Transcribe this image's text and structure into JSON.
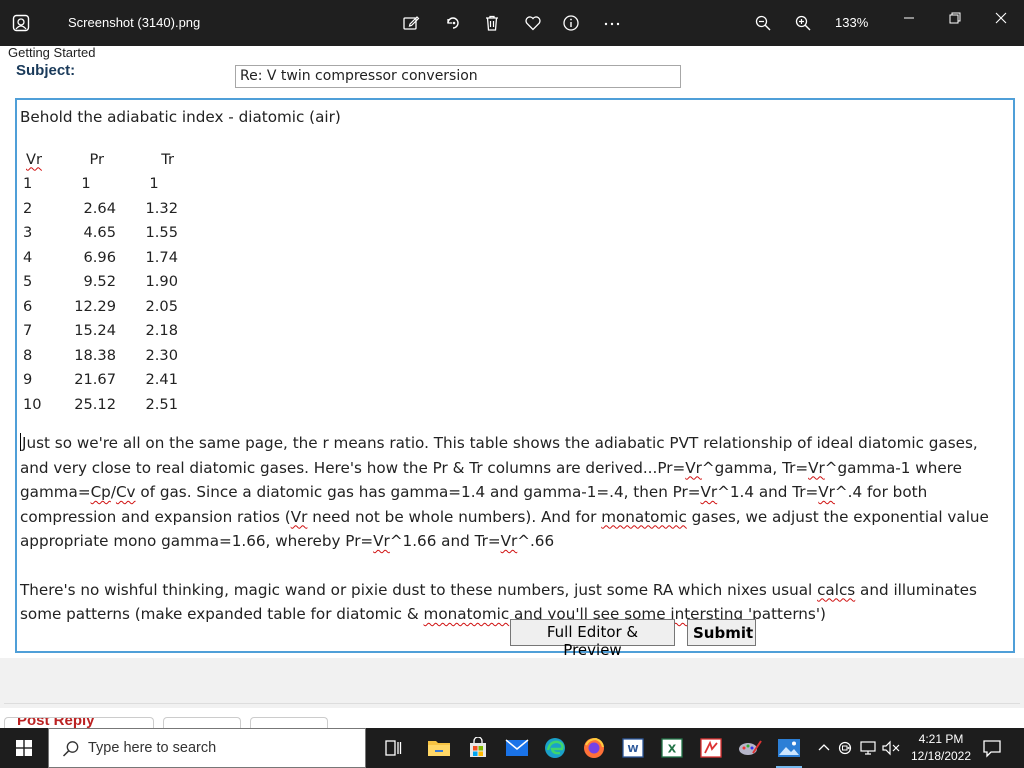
{
  "viewer": {
    "filename": "Screenshot (3140).png",
    "zoom_level": "133%",
    "toolbar_icons": [
      "edit-create-icon",
      "rotate-icon",
      "delete-icon",
      "favorite-heart-icon",
      "info-icon",
      "more-options-icon",
      "zoom-out-icon",
      "zoom-in-icon"
    ],
    "window_controls": [
      "minimize-icon",
      "restore-icon",
      "close-icon"
    ]
  },
  "page": {
    "breadcrumb": "Getting Started",
    "subject_label": "Subject:",
    "subject_value": "Re: V twin compressor conversion",
    "editor": {
      "intro": "Behold the adiabatic index - diatomic (air)",
      "table": {
        "headers": [
          "Vr",
          "Pr",
          "Tr"
        ],
        "rows": [
          [
            "1",
            "1",
            "1"
          ],
          [
            "2",
            "2.64",
            "1.32"
          ],
          [
            "3",
            "4.65",
            "1.55"
          ],
          [
            "4",
            "6.96",
            "1.74"
          ],
          [
            "5",
            "9.52",
            "1.90"
          ],
          [
            "6",
            "12.29",
            "2.05"
          ],
          [
            "7",
            "15.24",
            "2.18"
          ],
          [
            "8",
            "18.38",
            "2.30"
          ],
          [
            "9",
            "21.67",
            "2.41"
          ],
          [
            "10",
            "25.12",
            "2.51"
          ]
        ]
      },
      "paragraph1": {
        "p1": "Just so we're all on the same page, the r means ratio. This table shows the adiabatic PVT relationship of ideal diatomic gases, and very close to real diatomic gases. Here's how the Pr & Tr columns are derived...Pr=",
        "vr": "Vr",
        "p2": "^gamma, Tr=",
        "p3": "^gamma-1 where gamma=",
        "cp": "Cp",
        "slash": "/",
        "cv": "Cv",
        "p4": " of gas. Since a diatomic gas has gamma=1.4 and gamma-1=.4, then Pr=",
        "p5": "^1.4 and Tr=",
        "p6": "^.4 for both compression and expansion ratios (",
        "p7": " need not be whole numbers). And for ",
        "monatomic": "monatomic",
        "p8": " gases, we adjust the exponential value appropriate mono gamma=1.66, whereby Pr=",
        "p9": "^1.66 and Tr=",
        "p10": "^.66"
      },
      "paragraph2": {
        "p1": "There's no wishful thinking, magic wand or pixie dust to these numbers, just some RA which nixes usual ",
        "calcs": "calcs",
        "p2": " and illuminates some patterns (make expanded table for diatomic & ",
        "monatomic": "monatomic",
        "p3": " and you'll see some ",
        "intersting": "intersting",
        "p4": " 'patterns')"
      }
    },
    "buttons": {
      "full_editor": "Full Editor & Preview",
      "submit": "Submit"
    },
    "post_reply_label": "Post Reply"
  },
  "taskbar": {
    "search_placeholder": "Type here to search",
    "apps": [
      "task-view-icon",
      "file-explorer-icon",
      "microsoft-store-icon",
      "mail-icon",
      "edge-icon",
      "firefox-icon",
      "word-icon",
      "excel-icon",
      "pdf-app-icon",
      "paint-tool-icon",
      "photos-icon"
    ],
    "time": "4:21 PM",
    "date": "12/18/2022"
  }
}
